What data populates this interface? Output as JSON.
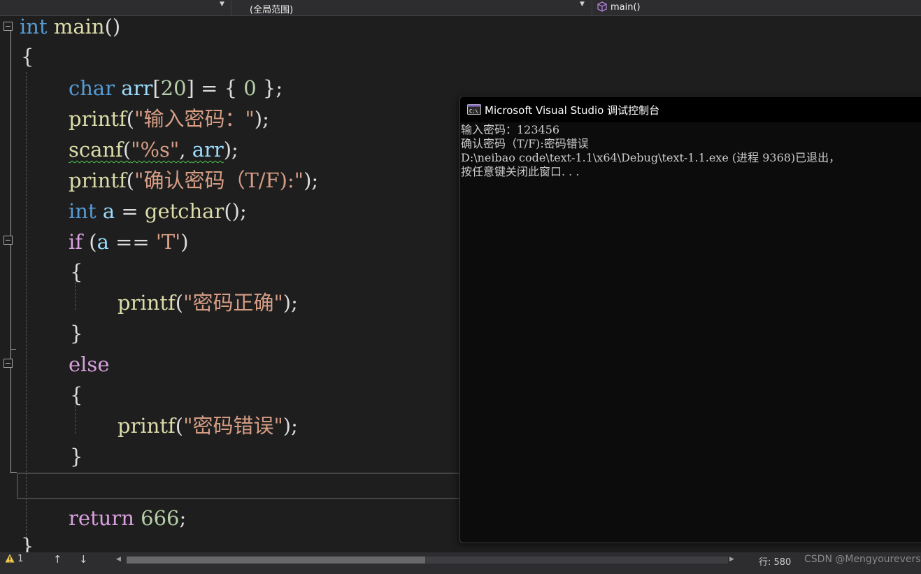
{
  "navbar": {
    "scope_dropdown": "(全局范围)",
    "member_dropdown": "main()"
  },
  "code": {
    "line1": {
      "kw": "int",
      "name": "main",
      "paren": "()"
    },
    "line2": {
      "brace": "{"
    },
    "line3": {
      "kw": "char",
      "name": "arr",
      "idx_open": "[",
      "size": "20",
      "rest": "] = { ",
      "init": "0",
      "end": " };"
    },
    "line4": {
      "fn": "printf",
      "open": "(",
      "str": "\"输入密码：\"",
      "end": ");"
    },
    "line5": {
      "fn": "scanf",
      "open": "(",
      "str": "\"%s\"",
      "sep": ", ",
      "arg": "arr",
      "end": ");"
    },
    "line6": {
      "fn": "printf",
      "open": "(",
      "str": "\"确认密码（T/F):\"",
      "end": ");"
    },
    "line7": {
      "kw": "int",
      "var": "a",
      "eq": " = ",
      "fn": "getchar",
      "end": "();"
    },
    "line8": {
      "kw": "if",
      "open": " (",
      "var": "a",
      "op": " == ",
      "chr": "'T'",
      "close": ")"
    },
    "line9": {
      "brace": "{"
    },
    "line10": {
      "fn": "printf",
      "open": "(",
      "str": "\"密码正确\"",
      "end": ");"
    },
    "line11": {
      "brace": "}"
    },
    "line12": {
      "kw": "else"
    },
    "line13": {
      "brace": "{"
    },
    "line14": {
      "fn": "printf",
      "open": "(",
      "str": "\"密码错误\"",
      "end": ");"
    },
    "line15": {
      "brace": "}"
    },
    "line17": {
      "kw": "return",
      "space": " ",
      "num": "666",
      "end": ";"
    },
    "line18": {
      "brace": "}"
    }
  },
  "console": {
    "title": "Microsoft Visual Studio 调试控制台",
    "icon_text": "C:\\",
    "lines": [
      "输入密码：123456",
      "确认密码（T/F):密码错误",
      "D:\\neibao code\\text-1.1\\x64\\Debug\\text-1.1.exe (进程 9368)已退出，",
      "按任意键关闭此窗口. . ."
    ]
  },
  "status": {
    "warnings": "1",
    "warning_icon": "warning-icon",
    "line_label": "行: 580",
    "watermark": "CSDN @Mengyoureversell"
  },
  "colors": {
    "editor_bg": "#1e1e1e",
    "keyword": "#569cd6",
    "control": "#d8a0df",
    "function": "#dcdcaa",
    "variable": "#9cdcfe",
    "string": "#d69d85",
    "number": "#b5cea8",
    "console_bg": "#0c0c0c"
  }
}
